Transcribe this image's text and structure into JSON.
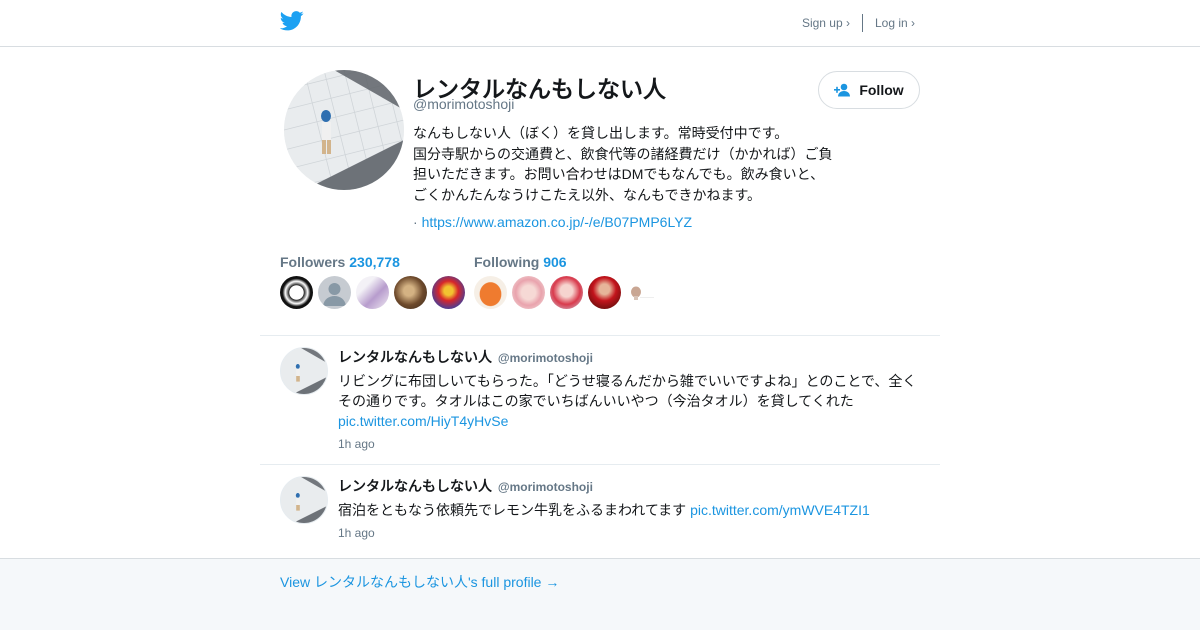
{
  "header": {
    "logo_icon": "twitter-bird-icon",
    "signup_label": "Sign up ›",
    "login_label": "Log in ›"
  },
  "profile": {
    "name": "レンタルなんもしない人",
    "handle": "@morimotoshoji",
    "bio_lines": [
      "なんもしない人（ぼく）を貸し出します。常時受付中です。",
      "国分寺駅からの交通費と、飲食代等の諸経費だけ（かかれば）ご負",
      "担いただきます。お問い合わせはDMでもなんでも。飲み食いと、",
      "ごくかんたんなうけこたえ以外、なんもできかねます。"
    ],
    "link_prefix": "·",
    "link": "https://www.amazon.co.jp/-/e/B07PMP6LYZ",
    "follow_label": "Follow"
  },
  "counts": {
    "followers_label": "Followers",
    "followers_value": "230,778",
    "following_label": "Following",
    "following_value": "906"
  },
  "tweets": [
    {
      "name": "レンタルなんもしない人",
      "handle": "@morimotoshoji",
      "text_lines": [
        "リビングに布団しいてもらった。「どうせ寝るんだから雑でいいですよね」とのことで、全く",
        "その通りです。タオルはこの家でいちばんいいやつ（今治タオル）を貸してくれた"
      ],
      "link": "pic.twitter.com/HiyT4yHvSe",
      "time": "1h ago"
    },
    {
      "name": "レンタルなんもしない人",
      "handle": "@morimotoshoji",
      "text": "宿泊をともなう依頼先でレモン牛乳をふるまわれてます",
      "link": "pic.twitter.com/ymWVE4TZI1",
      "time": "1h ago"
    }
  ],
  "footer": {
    "profile_link": "View レンタルなんもしない人's full profile →"
  },
  "colors": {
    "accent": "#1b95e0",
    "muted": "#657786",
    "footer_bg": "#f5f8fa"
  }
}
